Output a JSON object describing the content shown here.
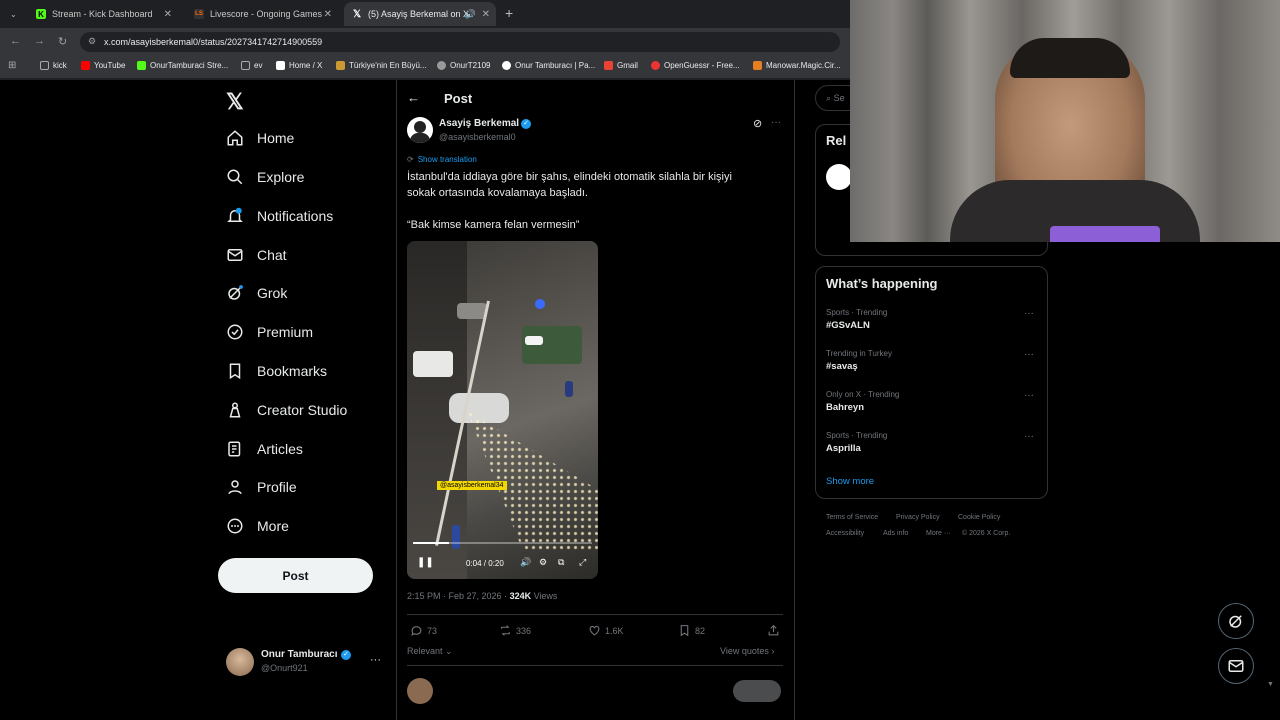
{
  "browser": {
    "tabs": [
      {
        "title": "Stream - Kick Dashboard",
        "favicon": "kick-icon"
      },
      {
        "title": "Livescore - Ongoing Games an",
        "favicon": "livescore-icon"
      },
      {
        "title": "(5) Asayiş Berkemal on X: \"",
        "favicon": "x-icon"
      }
    ],
    "url": "x.com/asayisberkemal0/status/2027341742714900559",
    "bookmarks": [
      "kick",
      "YouTube",
      "OnurTamburaci Stre...",
      "ev",
      "Home / X",
      "Türkiye'nin En Büyü...",
      "OnurT2109",
      "Onur Tamburacı | Pa...",
      "Gmail",
      "OpenGuessr - Free...",
      "Manowar.Magic.Cir..."
    ]
  },
  "sidebar": {
    "items": [
      {
        "label": "Home",
        "icon": "home-icon"
      },
      {
        "label": "Explore",
        "icon": "search-icon"
      },
      {
        "label": "Notifications",
        "icon": "bell-icon",
        "badge": "5"
      },
      {
        "label": "Chat",
        "icon": "mail-icon"
      },
      {
        "label": "Grok",
        "icon": "grok-icon"
      },
      {
        "label": "Premium",
        "icon": "premium-icon"
      },
      {
        "label": "Bookmarks",
        "icon": "bookmark-icon"
      },
      {
        "label": "Creator Studio",
        "icon": "creator-icon"
      },
      {
        "label": "Articles",
        "icon": "articles-icon"
      },
      {
        "label": "Profile",
        "icon": "person-icon"
      },
      {
        "label": "More",
        "icon": "more-circle-icon"
      }
    ],
    "post_label": "Post",
    "account": {
      "name": "Onur Tamburacı",
      "handle": "@Onurt921"
    }
  },
  "post": {
    "header": "Post",
    "author_name": "Asayiş Berkemal",
    "author_handle": "@asayisberkemal0",
    "show_translation": "Show translation",
    "text_line1": "İstanbul'da iddiaya göre bir şahıs, elindeki otomatik silahla bir kişiyi",
    "text_line2": "sokak ortasında kovalamaya başladı.",
    "quote": "“Bak kimse kamera felan vermesin”",
    "video_watermark": "@asayisberkemal34",
    "video_time": "0:04 / 0:20",
    "video_progress": 0.2,
    "timestamp": "2:15 PM · Feb 27, 2026 · ",
    "views_count": "324K",
    "views_label": " Views",
    "replies": "73",
    "reposts": "336",
    "likes": "1.6K",
    "bookmarks": "82",
    "relevant_label": "Relevant",
    "view_quotes": "View quotes"
  },
  "right": {
    "search_placeholder": "Se",
    "relevant_header": "Rel",
    "whats_happening": "What’s happening",
    "trends": [
      {
        "category": "Sports · Trending",
        "name": "#GSvALN"
      },
      {
        "category": "Trending in Turkey",
        "name": "#savaş"
      },
      {
        "category": "Only on X · Trending",
        "name": "Bahreyn"
      },
      {
        "category": "Sports · Trending",
        "name": "Asprilla"
      }
    ],
    "show_more": "Show more",
    "footer_row1": [
      "Terms of Service",
      "Privacy Policy",
      "Cookie Policy"
    ],
    "footer_row2": [
      "Accessibility",
      "Ads info",
      "More ···",
      "© 2026 X Corp."
    ]
  },
  "colors": {
    "accent": "#1d9bf0",
    "verified": "#1d9bf0",
    "link": "#1d9bf0"
  }
}
